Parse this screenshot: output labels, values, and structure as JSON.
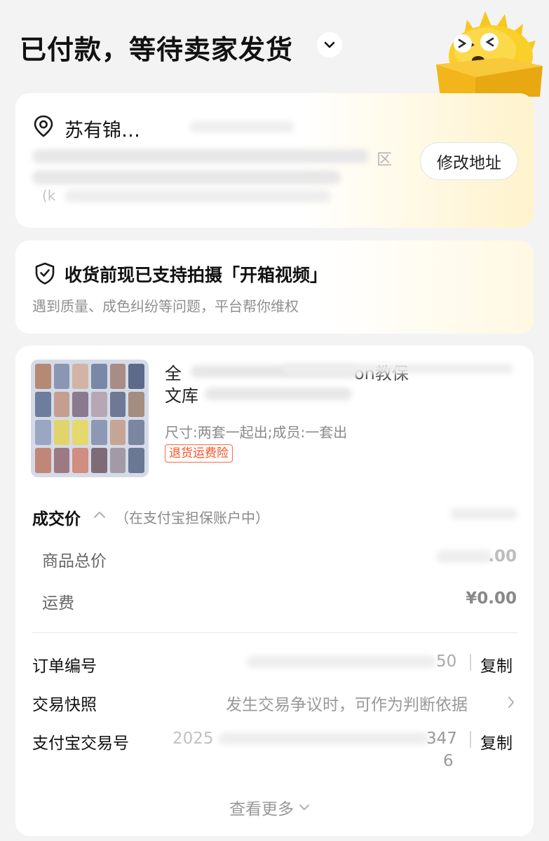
{
  "header": {
    "status_title": "已付款，等待卖家发货"
  },
  "address": {
    "recipient": "苏有锦…",
    "line1_fragment": "区",
    "line3_fragment": "(k",
    "edit_label": "修改地址"
  },
  "unboxing": {
    "title": "收货前现已支持拍摄「开箱视频」",
    "subtitle": "遇到质量、成色纠纷等问题，平台帮你维权"
  },
  "product": {
    "title_line1_start": "全",
    "title_line1_mid": "on教保",
    "title_line2_start": "文库",
    "spec": "尺寸:两套一起出;成员:一套出",
    "insurance_badge": "退货运费险"
  },
  "price": {
    "label": "成交价",
    "hint": "（在支付宝担保账户中）",
    "rows": [
      {
        "label": "商品总价",
        "value": ".00"
      },
      {
        "label": "运费",
        "value": "¥0.00"
      }
    ]
  },
  "order_info": {
    "order_no": {
      "label": "订单编号",
      "value_tail": "50",
      "copy": "复制"
    },
    "snapshot": {
      "label": "交易快照",
      "value": "发生交易争议时，可作为判断依据"
    },
    "alipay_no": {
      "label": "支付宝交易号",
      "value_head": "2025",
      "value_tail": "347",
      "value_wrap": "6",
      "copy": "复制"
    }
  },
  "footer": {
    "more_label": "查看更多"
  },
  "colors": {
    "page_bg": "#f3f3f3",
    "badge": "#ff4e1f",
    "mascot": "#f7c71f"
  }
}
